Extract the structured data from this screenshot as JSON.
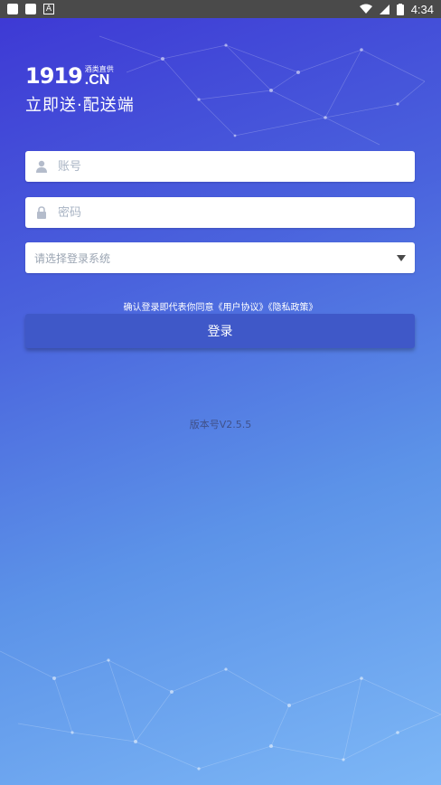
{
  "status_bar": {
    "time": "4:34"
  },
  "brand": {
    "logo_number": "1919",
    "logo_suffix": ".CN",
    "logo_sub": "酒类直供",
    "tagline": "立即送·配送端"
  },
  "form": {
    "account_placeholder": "账号",
    "password_placeholder": "密码",
    "system_select_placeholder": "请选择登录系统",
    "agreement_text": "确认登录即代表你同意《用户协议》《隐私政策》",
    "login_label": "登录"
  },
  "version": "版本号V2.5.5",
  "colors": {
    "button": "#3f58c8",
    "gradient_top": "#3d37d4",
    "gradient_bottom": "#7db7f6"
  }
}
